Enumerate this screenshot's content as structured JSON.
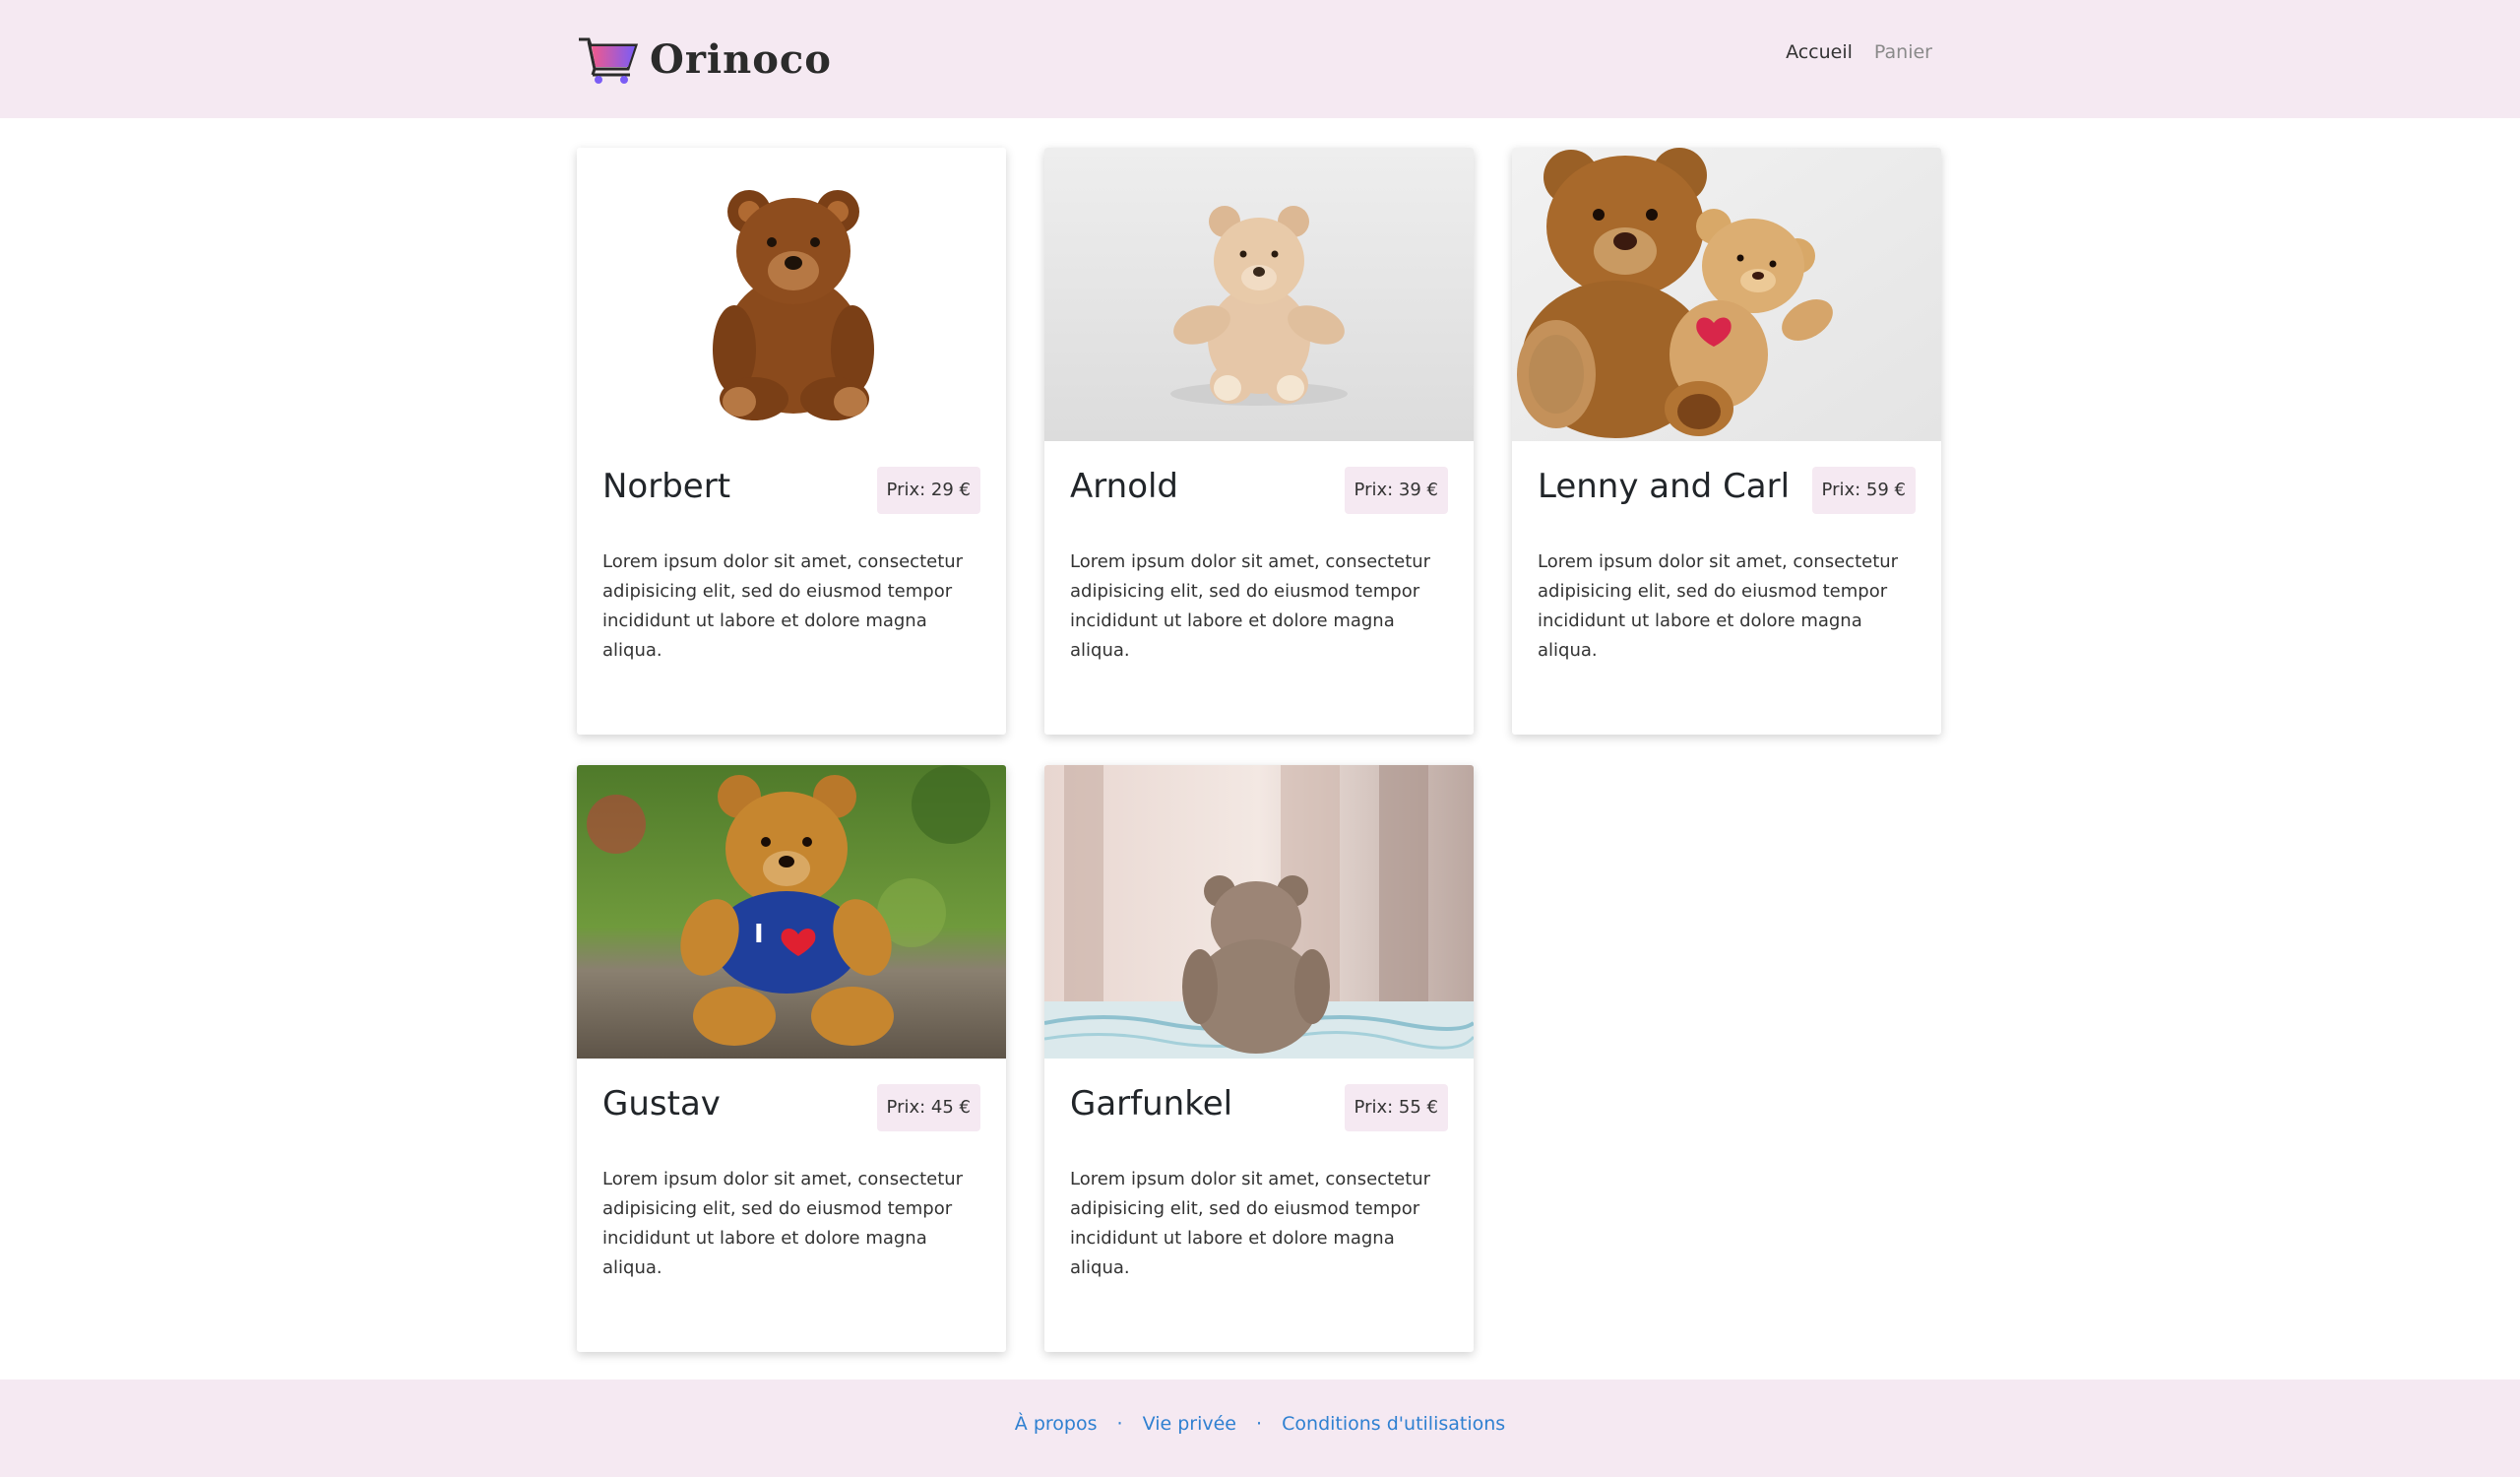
{
  "brand": {
    "name": "Orinoco",
    "logo_icon": "shopping-cart-icon",
    "colors": {
      "accent_start": "#f05a8c",
      "accent_end": "#7b5cf5"
    }
  },
  "nav": {
    "links": [
      {
        "label": "Accueil"
      },
      {
        "label": "Panier"
      }
    ]
  },
  "products": [
    {
      "name": "Norbert",
      "price": "Prix: 29 €",
      "description": "Lorem ipsum dolor sit amet, consectetur adipisicing elit, sed do eiusmod tempor incididunt ut labore et dolore magna aliqua."
    },
    {
      "name": "Arnold",
      "price": "Prix: 39 €",
      "description": "Lorem ipsum dolor sit amet, consectetur adipisicing elit, sed do eiusmod tempor incididunt ut labore et dolore magna aliqua."
    },
    {
      "name": "Lenny and Carl",
      "price": "Prix: 59 €",
      "description": "Lorem ipsum dolor sit amet, consectetur adipisicing elit, sed do eiusmod tempor incididunt ut labore et dolore magna aliqua."
    },
    {
      "name": "Gustav",
      "price": "Prix: 45 €",
      "description": "Lorem ipsum dolor sit amet, consectetur adipisicing elit, sed do eiusmod tempor incididunt ut labore et dolore magna aliqua."
    },
    {
      "name": "Garfunkel",
      "price": "Prix: 55 €",
      "description": "Lorem ipsum dolor sit amet, consectetur adipisicing elit, sed do eiusmod tempor incididunt ut labore et dolore magna aliqua."
    }
  ],
  "footer": {
    "links": [
      {
        "label": "À propos"
      },
      {
        "label": "Vie privée"
      },
      {
        "label": "Conditions d'utilisations"
      }
    ],
    "separator": "·"
  }
}
